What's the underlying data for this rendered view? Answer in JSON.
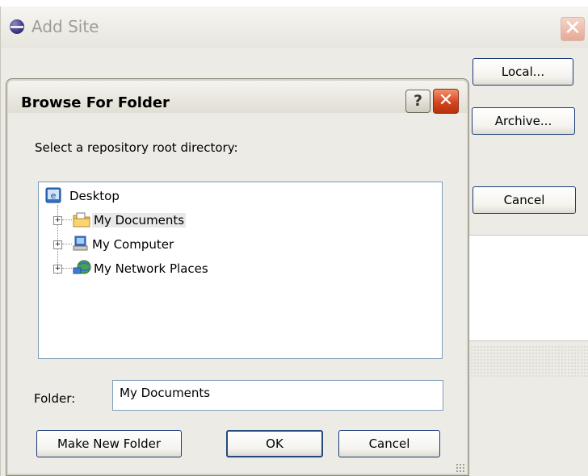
{
  "add_site": {
    "title": "Add Site",
    "close_symbol": "✕",
    "buttons": {
      "local": "Local...",
      "archive": "Archive...",
      "cancel": "Cancel"
    }
  },
  "browse_dialog": {
    "title": "Browse For Folder",
    "help_symbol": "?",
    "close_symbol": "✕",
    "prompt": "Select a repository root directory:",
    "tree": {
      "root": {
        "label": "Desktop",
        "icon": "desktop-icon"
      },
      "children": [
        {
          "label": "My Documents",
          "icon": "my-documents-folder-icon",
          "selected": true,
          "expander": "+"
        },
        {
          "label": "My Computer",
          "icon": "my-computer-icon",
          "selected": false,
          "expander": "+"
        },
        {
          "label": "My Network Places",
          "icon": "network-places-icon",
          "selected": false,
          "expander": "+"
        }
      ]
    },
    "folder_label": "Folder:",
    "folder_value": "My Documents",
    "buttons": {
      "make_new_folder": "Make New Folder",
      "ok": "OK",
      "cancel": "Cancel"
    }
  },
  "colors": {
    "window_bg": "#ecebe6",
    "button_border": "#1b3c79",
    "close_red": "#d4461f",
    "tree_border": "#7f9db9"
  }
}
